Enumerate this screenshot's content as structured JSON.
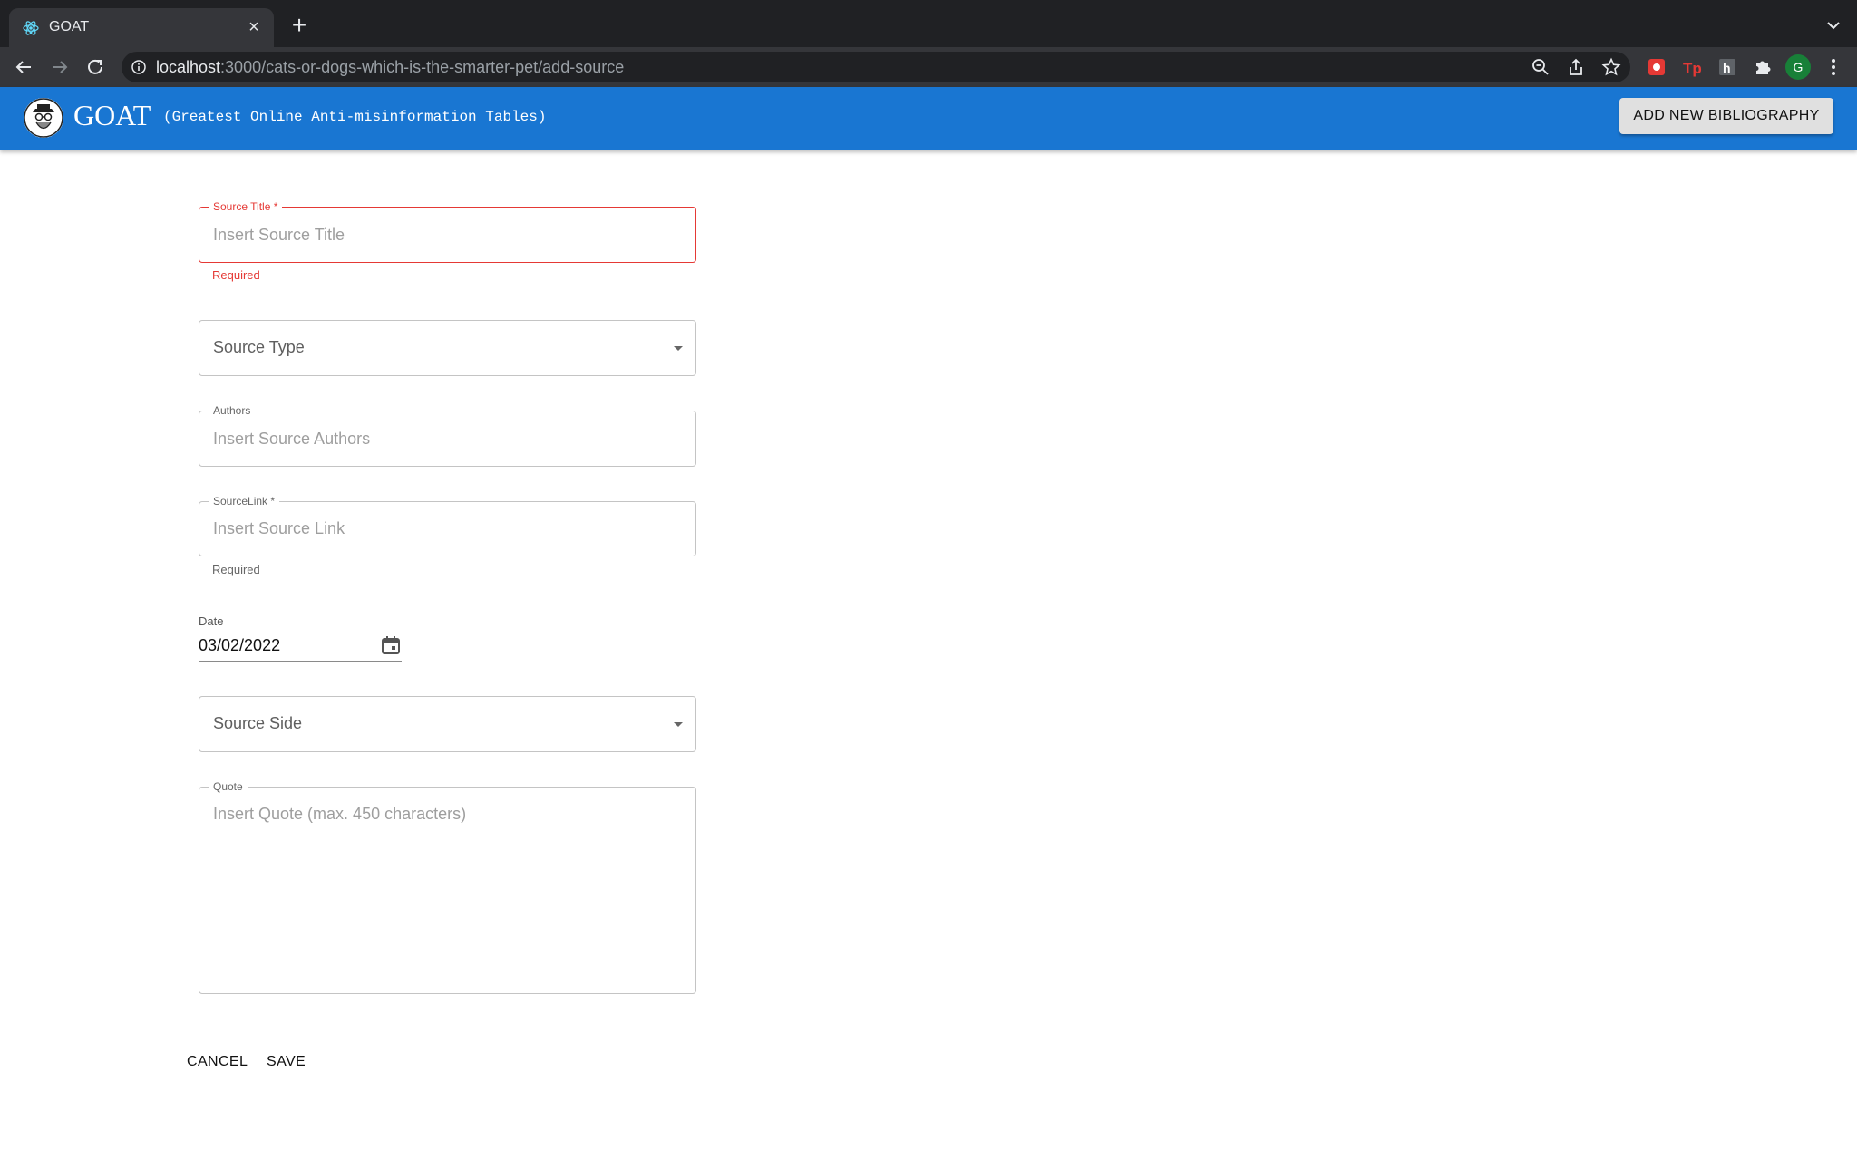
{
  "browser": {
    "tab_title": "GOAT",
    "url_host": "localhost",
    "url_path": ":3000/cats-or-dogs-which-is-the-smarter-pet/add-source",
    "profile_initial": "G"
  },
  "appbar": {
    "brand": "GOAT",
    "tagline": "(Greatest Online Anti-misinformation Tables)",
    "add_bibliography_label": "ADD NEW BIBLIOGRAPHY"
  },
  "form": {
    "source_title": {
      "label": "Source Title *",
      "placeholder": "Insert Source Title",
      "helper": "Required"
    },
    "source_type": {
      "value": "Source Type"
    },
    "authors": {
      "label": "Authors",
      "placeholder": "Insert Source Authors"
    },
    "source_link": {
      "label": "SourceLink *",
      "placeholder": "Insert Source Link",
      "helper": "Required"
    },
    "date": {
      "label": "Date",
      "value": "03/02/2022"
    },
    "source_side": {
      "value": "Source Side"
    },
    "quote": {
      "label": "Quote",
      "placeholder": "Insert Quote (max. 450 characters)"
    },
    "cancel_label": "CANCEL",
    "save_label": "SAVE"
  },
  "colors": {
    "appbar": "#1976d2",
    "error": "#e53935",
    "browser_dark": "#202124"
  }
}
